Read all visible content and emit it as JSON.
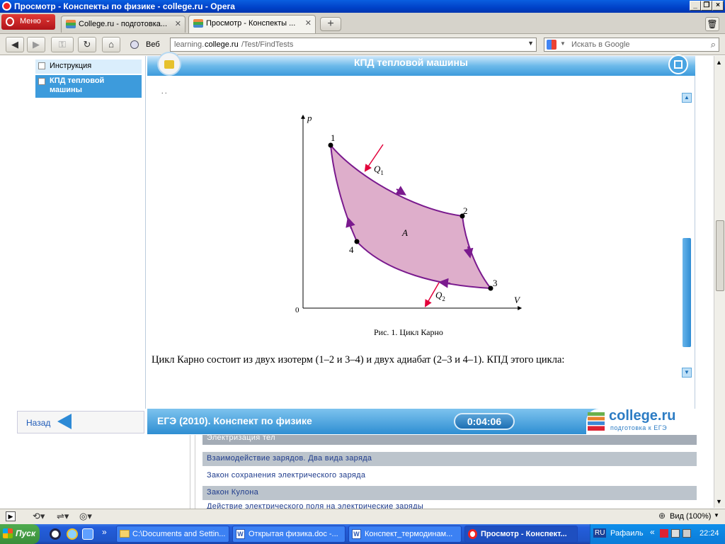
{
  "window": {
    "title": "Просмотр - Конспекты по физике - college.ru - Opera"
  },
  "tabs": {
    "menu_label": "Меню",
    "items": [
      {
        "label": "College.ru - подготовка..."
      },
      {
        "label": "Просмотр - Конспекты ..."
      }
    ]
  },
  "navbar": {
    "address_label": "Веб",
    "url_prefix": "learning.",
    "url_host": "college.ru",
    "url_path": "/Test/FindTests",
    "search_placeholder": "Искать в Google"
  },
  "sidebar": {
    "items": [
      {
        "label": "Инструкция"
      },
      {
        "label": "КПД тепловой машины"
      }
    ]
  },
  "content": {
    "header_title": "КПД тепловой машины",
    "top_fragment": ". .",
    "figure_caption": "Рис. 1. Цикл Карно",
    "paragraph": "Цикл Карно состоит из двух изотерм (1–2 и 3–4) и двух адиабат (2–3 и 4–1). КПД этого цикла:",
    "diagram": {
      "axis_p": "p",
      "axis_v": "V",
      "origin": "0",
      "work_label": "A",
      "points": [
        "1",
        "2",
        "3",
        "4"
      ],
      "q1": "Q",
      "q1_sub": "1",
      "q2": "Q",
      "q2_sub": "2",
      "fill_color": "#deaecb",
      "line_color": "#7a1a8e"
    }
  },
  "footer": {
    "back_label": "Назад",
    "course_title": "ЕГЭ (2010). Конспект по физике",
    "timer": "0:04:06",
    "logo_text": "college.ru",
    "logo_subtext": "подготовка к ЕГЭ"
  },
  "background_links": [
    {
      "label": "Электризация тел"
    },
    {
      "label": "Взаимодействие зарядов. Два вида заряда"
    },
    {
      "label": "Закон сохранения электрического заряда"
    },
    {
      "label": "Закон Кулона"
    },
    {
      "label": "Действие электрического поля на электрические заряды"
    }
  ],
  "statusbar": {
    "zoom_label": "Вид (100%)"
  },
  "taskbar": {
    "start_label": "Пуск",
    "tasks": [
      {
        "label": "C:\\Documents and Settin..."
      },
      {
        "label": "Открытая физика.doc -..."
      },
      {
        "label": "Конспект_термодинам..."
      },
      {
        "label": "Просмотр - Конспект..."
      }
    ],
    "lang": "RU",
    "user": "Рафаиль",
    "clock": "22:24"
  }
}
